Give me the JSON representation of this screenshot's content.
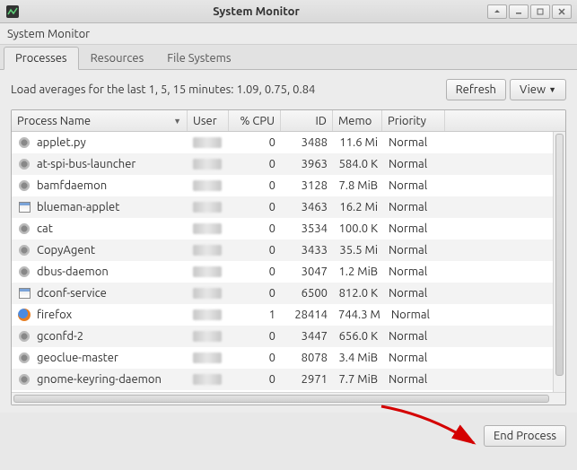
{
  "titlebar": {
    "title": "System Monitor"
  },
  "menubar": {
    "app_menu": "System Monitor"
  },
  "tabs": [
    {
      "label": "Processes",
      "active": true
    },
    {
      "label": "Resources",
      "active": false
    },
    {
      "label": "File Systems",
      "active": false
    }
  ],
  "load_avg_text": "Load averages for the last 1, 5, 15 minutes: 1.09, 0.75, 0.84",
  "buttons": {
    "refresh": "Refresh",
    "view": "View",
    "end_process": "End Process"
  },
  "columns": {
    "process_name": "Process Name",
    "user": "User",
    "cpu": "% CPU",
    "id": "ID",
    "memo": "Memo",
    "priority": "Priority"
  },
  "processes": [
    {
      "icon": "gear",
      "name": "applet.py",
      "cpu": 0,
      "id": 3488,
      "mem": "11.6 Mi",
      "prio": "Normal"
    },
    {
      "icon": "gear",
      "name": "at-spi-bus-launcher",
      "cpu": 0,
      "id": 3963,
      "mem": "584.0 K",
      "prio": "Normal"
    },
    {
      "icon": "gear",
      "name": "bamfdaemon",
      "cpu": 0,
      "id": 3128,
      "mem": "7.8 MiB",
      "prio": "Normal"
    },
    {
      "icon": "window",
      "name": "blueman-applet",
      "cpu": 0,
      "id": 3463,
      "mem": "16.2 Mi",
      "prio": "Normal"
    },
    {
      "icon": "gear",
      "name": "cat",
      "cpu": 0,
      "id": 3534,
      "mem": "100.0 K",
      "prio": "Normal"
    },
    {
      "icon": "gear",
      "name": "CopyAgent",
      "cpu": 0,
      "id": 3433,
      "mem": "35.5 Mi",
      "prio": "Normal"
    },
    {
      "icon": "gear",
      "name": "dbus-daemon",
      "cpu": 0,
      "id": 3047,
      "mem": "1.2 MiB",
      "prio": "Normal"
    },
    {
      "icon": "window",
      "name": "dconf-service",
      "cpu": 0,
      "id": 6500,
      "mem": "812.0 K",
      "prio": "Normal"
    },
    {
      "icon": "firefox",
      "name": "firefox",
      "cpu": 1,
      "id": 28414,
      "mem": "744.3 M",
      "prio": "Normal"
    },
    {
      "icon": "gear",
      "name": "gconfd-2",
      "cpu": 0,
      "id": 3447,
      "mem": "656.0 K",
      "prio": "Normal"
    },
    {
      "icon": "gear",
      "name": "geoclue-master",
      "cpu": 0,
      "id": 8078,
      "mem": "3.4 MiB",
      "prio": "Normal"
    },
    {
      "icon": "gear",
      "name": "gnome-keyring-daemon",
      "cpu": 0,
      "id": 2971,
      "mem": "7.7 MiB",
      "prio": "Normal"
    }
  ]
}
